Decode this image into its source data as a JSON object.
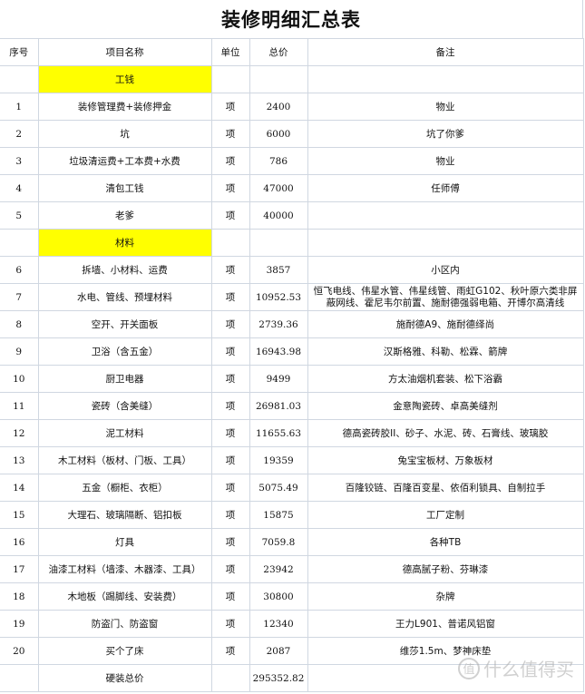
{
  "title": "装修明细汇总表",
  "columns": [
    "序号",
    "项目名称",
    "单位",
    "总价",
    "备注"
  ],
  "colors": {
    "section_highlight": "#ffff00",
    "grid": "#d0d7e1"
  },
  "sections": [
    {
      "label": "工钱",
      "rows": [
        {
          "no": "1",
          "name": "装修管理费+装修押金",
          "unit": "项",
          "price": "2400",
          "remark": "物业"
        },
        {
          "no": "2",
          "name": "坑",
          "unit": "项",
          "price": "6000",
          "remark": "坑了你爹"
        },
        {
          "no": "3",
          "name": "垃圾清运费+工本费+水费",
          "unit": "项",
          "price": "786",
          "remark": "物业"
        },
        {
          "no": "4",
          "name": "清包工钱",
          "unit": "项",
          "price": "47000",
          "remark": "任师傅"
        },
        {
          "no": "5",
          "name": "老爹",
          "unit": "项",
          "price": "40000",
          "remark": ""
        }
      ]
    },
    {
      "label": "材料",
      "rows": [
        {
          "no": "6",
          "name": "拆墙、小材料、运费",
          "unit": "项",
          "price": "3857",
          "remark": "小区内"
        },
        {
          "no": "7",
          "name": "水电、管线、预埋材料",
          "unit": "项",
          "price": "10952.53",
          "remark": "恒飞电线、伟星水管、伟星线管、雨虹G102、秋叶原六类非屏蔽网线、霍尼韦尔前置、施耐德强弱电箱、开博尔高清线"
        },
        {
          "no": "8",
          "name": "空开、开关面板",
          "unit": "项",
          "price": "2739.36",
          "remark": "施耐德A9、施耐德绎尚"
        },
        {
          "no": "9",
          "name": "卫浴（含五金）",
          "unit": "项",
          "price": "16943.98",
          "remark": "汉斯格雅、科勒、松霖、箭牌"
        },
        {
          "no": "10",
          "name": "厨卫电器",
          "unit": "项",
          "price": "9499",
          "remark": "方太油烟机套装、松下浴霸"
        },
        {
          "no": "11",
          "name": "瓷砖（含美缝）",
          "unit": "项",
          "price": "26981.03",
          "remark": "金意陶瓷砖、卓高美缝剂"
        },
        {
          "no": "12",
          "name": "泥工材料",
          "unit": "项",
          "price": "11655.63",
          "remark": "德高瓷砖胶II、砂子、水泥、砖、石膏线、玻璃胶"
        },
        {
          "no": "13",
          "name": "木工材料（板材、门板、工具）",
          "unit": "项",
          "price": "19359",
          "remark": "兔宝宝板材、万象板材"
        },
        {
          "no": "14",
          "name": "五金（橱柜、衣柜）",
          "unit": "项",
          "price": "5075.49",
          "remark": "百隆铰链、百隆百变星、依佰利锁具、自制拉手"
        },
        {
          "no": "15",
          "name": "大理石、玻璃隔断、铝扣板",
          "unit": "项",
          "price": "15875",
          "remark": "工厂定制"
        },
        {
          "no": "16",
          "name": "灯具",
          "unit": "项",
          "price": "7059.8",
          "remark": "各种TB"
        },
        {
          "no": "17",
          "name": "油漆工材料（墙漆、木器漆、工具）",
          "unit": "项",
          "price": "23942",
          "remark": "德高腻子粉、芬琳漆"
        },
        {
          "no": "18",
          "name": "木地板（踢脚线、安装费）",
          "unit": "项",
          "price": "30800",
          "remark": "杂牌"
        },
        {
          "no": "19",
          "name": "防盗门、防盗窗",
          "unit": "项",
          "price": "12340",
          "remark": "王力L901、普诺风铝窗"
        },
        {
          "no": "20",
          "name": "买个了床",
          "unit": "项",
          "price": "2087",
          "remark": "维莎1.5m、梦神床垫"
        }
      ]
    }
  ],
  "total": {
    "label": "硬装总价",
    "price": "295352.82"
  },
  "watermark": {
    "icon": "值",
    "text": "什么值得买"
  }
}
